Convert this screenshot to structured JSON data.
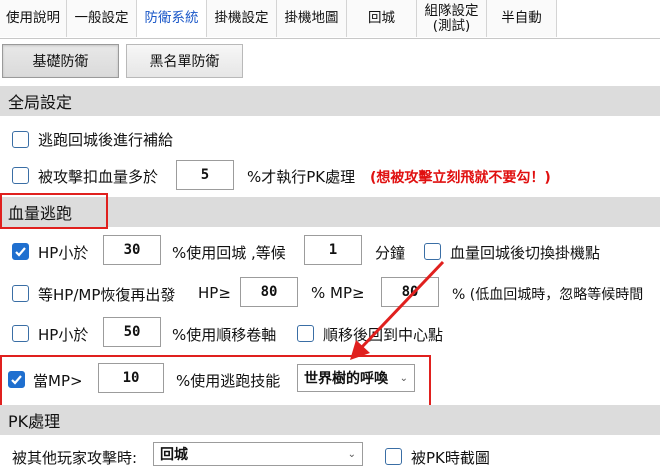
{
  "tabs": [
    {
      "label": "使用說明"
    },
    {
      "label": "一般設定"
    },
    {
      "label": "防衛系統"
    },
    {
      "label": "掛機設定"
    },
    {
      "label": "掛機地圖"
    },
    {
      "label": "回城"
    },
    {
      "label_line1": "組隊設定",
      "label_line2": "(測試)"
    },
    {
      "label": "半自動"
    }
  ],
  "subtabs": {
    "basic": "基礎防衛",
    "blacklist": "黑名單防衛"
  },
  "global": {
    "title": "全局設定",
    "opt1": "逃跑回城後進行補給",
    "opt2_prefix": "被攻擊扣血量多於",
    "opt2_value": "5",
    "opt2_suffix": "%才執行PK處理",
    "opt2_note": "(想被攻擊立刻飛就不要勾！)"
  },
  "escape": {
    "title": "血量逃跑",
    "row1_label": "HP小於",
    "row1_value": "30",
    "row1_mid": "%使用回城 ,等候",
    "row1_wait": "1",
    "row1_unit": "分鐘",
    "row1_extra": "血量回城後切換掛機點",
    "row2_label": "等HP/MP恢復再出發",
    "row2_hp": "HP≥",
    "row2_hp_value": "80",
    "row2_mp": "%  MP≥",
    "row2_mp_value": "80",
    "row2_suffix": "% (低血回城時，忽略等候時間",
    "row3_label": "HP小於",
    "row3_value": "50",
    "row3_mid": "%使用順移卷軸",
    "row3_extra": "順移後回到中心點",
    "row4_label": "當MP>",
    "row4_value": "10",
    "row4_mid": "%使用逃跑技能",
    "row4_skill": "世界樹的呼喚"
  },
  "pk": {
    "title": "PK處理",
    "attacked_label": "被其他玩家攻擊時:",
    "attacked_action": "回城",
    "screenshot_label": "被PK時截圖"
  },
  "colors": {
    "accent": "#1f6fcf",
    "annotation": "#e0201e"
  }
}
